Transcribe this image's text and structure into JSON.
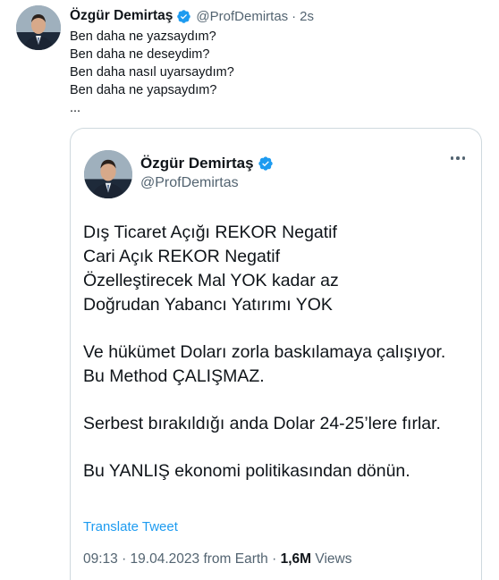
{
  "tweet": {
    "author_name": "Özgür Demirtaş",
    "author_handle": "@ProfDemirtas",
    "separator": "·",
    "time": "2s",
    "lines": [
      "Ben daha ne yazsaydım?",
      "Ben daha ne deseydim?",
      "Ben daha nasıl uyarsaydım?",
      "Ben daha ne yapsaydım?",
      "..."
    ]
  },
  "quoted_tweet": {
    "author_name": "Özgür Demirtaş",
    "author_handle": "@ProfDemirtas",
    "more_icon": "more-horizontal-icon",
    "paragraphs": [
      [
        "Dış Ticaret Açığı REKOR Negatif",
        "Cari Açık REKOR Negatif",
        "Özelleştirecek Mal YOK kadar az",
        "Doğrudan Yabancı Yatırımı YOK"
      ],
      [
        "Ve hükümet Doları zorla baskılamaya çalışıyor.",
        "Bu Method ÇALIŞMAZ."
      ],
      [
        "Serbest bırakıldığı anda Dolar 24-25’lere fırlar."
      ],
      [
        "Bu YANLIŞ ekonomi politikasından dönün."
      ]
    ],
    "translate_label": "Translate Tweet",
    "timestamp": "09:13 · 19.04.2023 from Earth",
    "meta_separator": "·",
    "views_count": "1,6M",
    "views_label": "Views"
  },
  "colors": {
    "verified_badge": "#1d9bf0",
    "link": "#1d9bf0",
    "secondary_text": "#536471",
    "primary_text": "#0f1419",
    "card_border": "#cfd9de"
  }
}
